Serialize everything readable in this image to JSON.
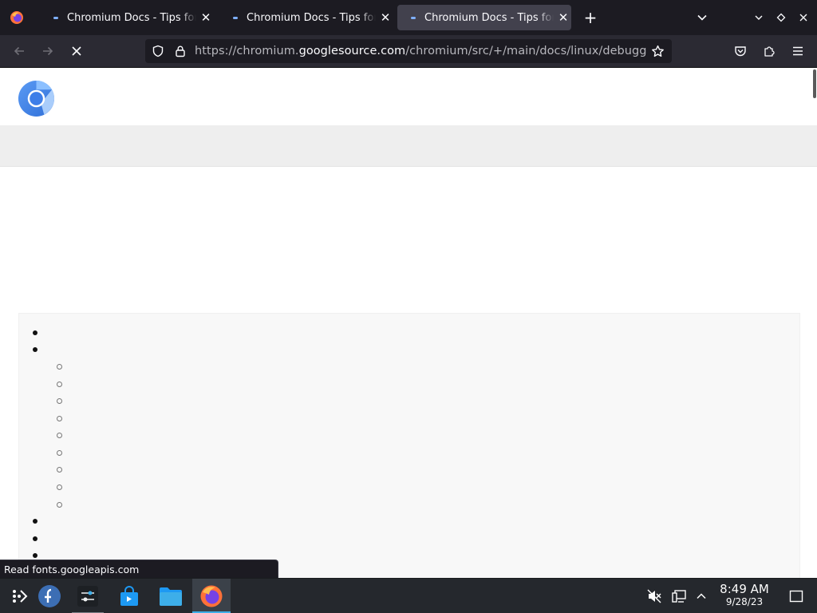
{
  "browser": {
    "tabs": [
      {
        "title": "Chromium Docs - Tips for debugging on Linux",
        "active": false
      },
      {
        "title": "Chromium Docs - Tips for debugging on Linux",
        "active": false
      },
      {
        "title": "Chromium Docs - Tips for debugging on Linux",
        "active": true
      }
    ],
    "close_glyph": "✕",
    "new_tab_glyph": "+",
    "url": {
      "prefix": "https://chromium.",
      "domain": "googlesource.com",
      "path": "/chromium/src/+/main/docs/linux/debugging.md"
    },
    "status_text": "Read fonts.googleapis.com",
    "loading": true
  },
  "page": {
    "toc_bullets": [
      "disc",
      "disc",
      "circle",
      "circle",
      "circle",
      "circle",
      "circle",
      "circle",
      "circle",
      "circle",
      "circle",
      "disc",
      "disc",
      "disc"
    ]
  },
  "taskbar": {
    "clock_time": "8:49 AM",
    "clock_date": "9/28/23"
  },
  "colors": {
    "tabstrip": "#1c1b22",
    "toolbar": "#2b2a33",
    "active_tab": "#42414d",
    "taskbar": "#25282d",
    "accent": "#3daee9"
  }
}
